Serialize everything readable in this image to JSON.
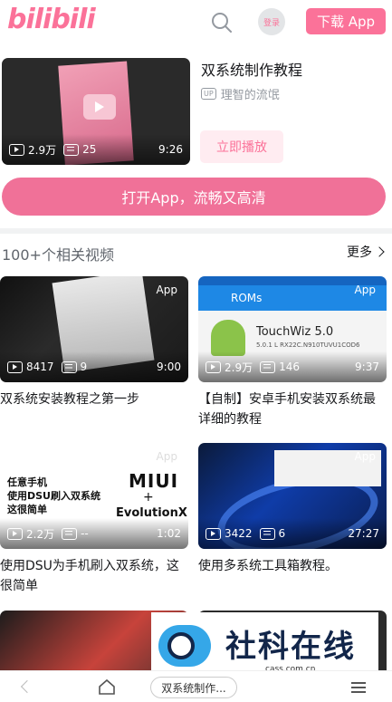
{
  "header": {
    "logo": "bilibili",
    "login_label": "登录",
    "download_label": "下载 App"
  },
  "featured": {
    "title": "双系统制作教程",
    "up_badge": "UP",
    "author": "理智的流氓",
    "views": "2.9万",
    "danmaku": "25",
    "duration": "9:26",
    "play_label": "立即播放"
  },
  "open_app_label": "打开App，流畅又高清",
  "related": {
    "title": "100+个相关视频",
    "more_label": "更多",
    "app_tag": "App",
    "videos": [
      {
        "title": "双系统安装教程之第一步",
        "views": "8417",
        "danmaku": "9",
        "duration": "9:00"
      },
      {
        "title": "【自制】安卓手机安装双系统最详细的教程",
        "views": "2.9万",
        "danmaku": "146",
        "duration": "9:37"
      },
      {
        "title": "使用DSU为手机刷入双系统，这很简单",
        "views": "2.2万",
        "danmaku": "--",
        "duration": "1:02"
      },
      {
        "title": "使用多系统工具箱教程。",
        "views": "3422",
        "danmaku": "6",
        "duration": "27:27"
      }
    ]
  },
  "thumb_text": {
    "roms_bar": "ROMs",
    "touchwiz": "TouchWiz 5.0",
    "touchwiz_sub": "5.0.1 L RX22C.N910TUVU1COD6",
    "dsu_lines": "任意手机\n使用DSU刷入双系统\n这很简单",
    "miui": "MIUI",
    "plus": "+",
    "evox": "EvolutionX"
  },
  "watermark": {
    "text": "社科在线",
    "url": "cass.com.cn"
  },
  "bottom_nav": {
    "tab_label": "双系统制作..."
  },
  "colors": {
    "brand_pink": "#fb7299",
    "open_app_pink": "#f07198",
    "text_dark": "#18191c",
    "text_grey": "#61666d"
  }
}
